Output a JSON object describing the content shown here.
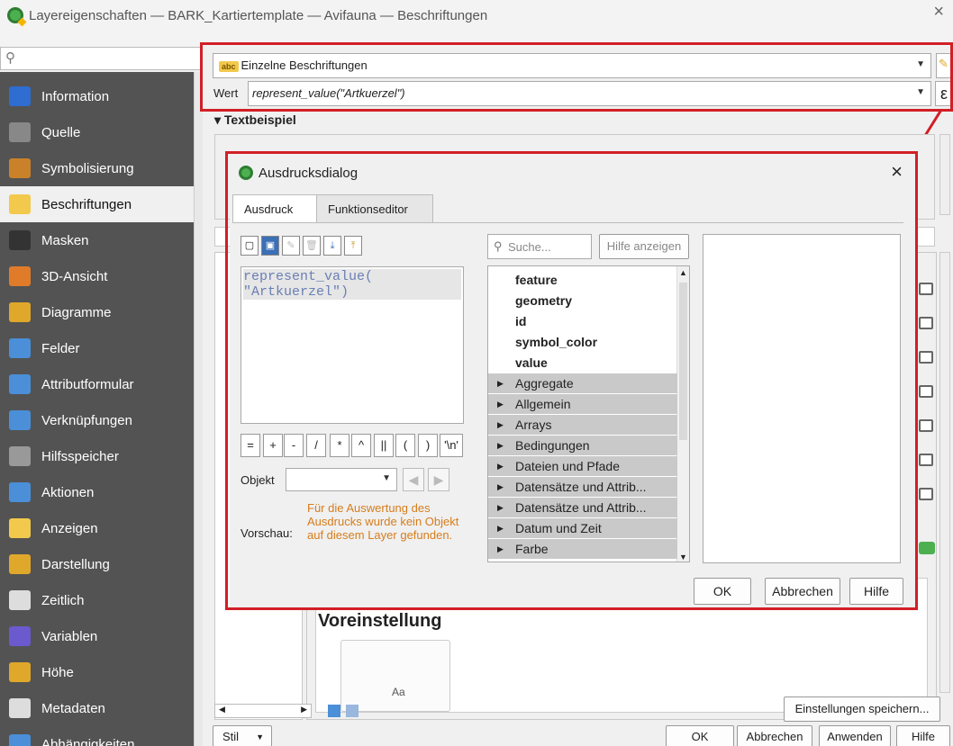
{
  "window": {
    "title": "Layereigenschaften — BARK_Kartiertemplate — Avifauna — Beschriftungen",
    "close": "×"
  },
  "sidebar": {
    "search_icon": "search-icon",
    "items": [
      {
        "label": "Information",
        "icon": "info-icon",
        "color": "#2f6dd0"
      },
      {
        "label": "Quelle",
        "icon": "source-icon",
        "color": "#888888"
      },
      {
        "label": "Symbolisierung",
        "icon": "brush-icon",
        "color": "#c9822a"
      },
      {
        "label": "Beschriftungen",
        "icon": "abc-label-icon",
        "color": "#f2c94c"
      },
      {
        "label": "Masken",
        "icon": "mask-icon",
        "color": "#333333"
      },
      {
        "label": "3D-Ansicht",
        "icon": "cube-3d-icon",
        "color": "#e07b2a"
      },
      {
        "label": "Diagramme",
        "icon": "chart-icon",
        "color": "#e0a82a"
      },
      {
        "label": "Felder",
        "icon": "fields-icon",
        "color": "#4a8fd8"
      },
      {
        "label": "Attributformular",
        "icon": "form-icon",
        "color": "#4a8fd8"
      },
      {
        "label": "Verknüpfungen",
        "icon": "join-icon",
        "color": "#4a8fd8"
      },
      {
        "label": "Hilfsspeicher",
        "icon": "storage-icon",
        "color": "#999999"
      },
      {
        "label": "Aktionen",
        "icon": "gear-icon",
        "color": "#4a8fd8"
      },
      {
        "label": "Anzeigen",
        "icon": "speech-bubble-icon",
        "color": "#f2c94c"
      },
      {
        "label": "Darstellung",
        "icon": "paintbrush-icon",
        "color": "#e0a82a"
      },
      {
        "label": "Zeitlich",
        "icon": "clock-icon",
        "color": "#dddddd"
      },
      {
        "label": "Variablen",
        "icon": "epsilon-icon",
        "color": "#6a5acd"
      },
      {
        "label": "Höhe",
        "icon": "elevation-icon",
        "color": "#e0a82a"
      },
      {
        "label": "Metadaten",
        "icon": "metadata-icon",
        "color": "#dddddd"
      },
      {
        "label": "Abhängigkeiten",
        "icon": "dependency-icon",
        "color": "#4a8fd8"
      }
    ]
  },
  "labels": {
    "mode_value": "Einzelne Beschriftungen",
    "wert_label": "Wert",
    "wert_value": "represent_value(\"Artkuerzel\")",
    "epsilon_button": "ε",
    "textbeispiel": "▾ Textbeispiel",
    "voreinstellung": "Voreinstellung",
    "aa_sample": "Aa",
    "save_settings": "Einstellungen speichern...",
    "style_label": "Stil",
    "ok": "OK",
    "cancel": "Abbrechen",
    "apply": "Anwenden",
    "help": "Hilfe"
  },
  "dialog": {
    "title": "Ausdrucksdialog",
    "close": "×",
    "tabs": [
      "Ausdruck",
      "Funktionseditor"
    ],
    "expression_line1": "represent_value(",
    "expression_line2": "\"Artkuerzel\")",
    "operators": [
      "=",
      "+",
      "-",
      "/",
      "*",
      "^",
      "||",
      "(",
      ")",
      "'\\n'"
    ],
    "object_label": "Objekt",
    "preview_label": "Vorschau:",
    "preview_message": "Für die Auswertung des Ausdrucks wurde kein Objekt auf diesem Layer gefunden.",
    "search_placeholder": "Suche...",
    "show_help": "Hilfe anzeigen",
    "fields": [
      "feature",
      "geometry",
      "id",
      "symbol_color",
      "value"
    ],
    "groups": [
      "Aggregate",
      "Allgemein",
      "Arrays",
      "Bedingungen",
      "Dateien und Pfade",
      "Datensätze und Attrib...",
      "Datensätze und Attrib...",
      "Datum und Zeit",
      "Farbe"
    ],
    "ok": "OK",
    "cancel": "Abbrechen",
    "help": "Hilfe"
  },
  "colors": {
    "highlight_red": "#d11f26",
    "sidebar_bg": "#535353",
    "preview_orange": "#d67d1c"
  }
}
